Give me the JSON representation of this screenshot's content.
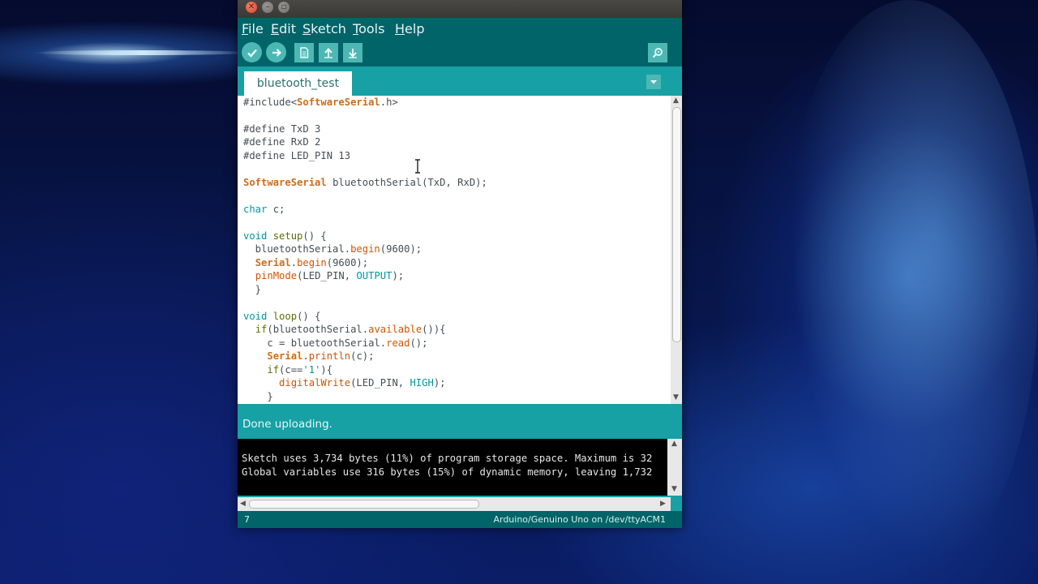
{
  "window": {
    "menu": [
      "File",
      "Edit",
      "Sketch",
      "Tools",
      "Help"
    ],
    "menu_mnemonic_rest": [
      "ile",
      "dit",
      "ketch",
      "ools",
      "elp"
    ],
    "menu_mnemonic_first": [
      "F",
      "E",
      "S",
      "T",
      "H"
    ]
  },
  "toolbar": {
    "verify_icon": "checkmark-icon",
    "upload_icon": "arrow-right-icon",
    "new_icon": "document-icon",
    "open_icon": "arrow-up-icon",
    "save_icon": "arrow-down-icon",
    "serial_monitor_icon": "magnifier-icon"
  },
  "tab": {
    "name": "bluetooth_test"
  },
  "code": {
    "l1_a": "#include<",
    "l1_b": "SoftwareSerial",
    "l1_c": ".h>",
    "l3": "#define TxD 3",
    "l4": "#define RxD 2",
    "l5": "#define LED_PIN 13",
    "l7_a": "SoftwareSerial",
    "l7_b": " bluetoothSerial(TxD, RxD);",
    "l9_a": "char",
    "l9_b": " c;",
    "l11_a": "void",
    "l11_b": " ",
    "l11_c": "setup",
    "l11_d": "() {",
    "l12_a": "  bluetoothSerial.",
    "l12_b": "begin",
    "l12_c": "(9600);",
    "l13_a": "  ",
    "l13_b": "Serial",
    "l13_c": ".",
    "l13_d": "begin",
    "l13_e": "(9600);",
    "l14_a": "  ",
    "l14_b": "pinMode",
    "l14_c": "(LED_PIN, ",
    "l14_d": "OUTPUT",
    "l14_e": ");",
    "l15": "  }",
    "l17_a": "void",
    "l17_b": " ",
    "l17_c": "loop",
    "l17_d": "() {",
    "l18_a": "  ",
    "l18_b": "if",
    "l18_c": "(bluetoothSerial.",
    "l18_d": "available",
    "l18_e": "()){",
    "l19_a": "    c = bluetoothSerial.",
    "l19_b": "read",
    "l19_c": "();",
    "l20_a": "    ",
    "l20_b": "Serial",
    "l20_c": ".",
    "l20_d": "println",
    "l20_e": "(c);",
    "l21_a": "    ",
    "l21_b": "if",
    "l21_c": "(c==",
    "l21_d": "'1'",
    "l21_e": "){",
    "l22_a": "      ",
    "l22_b": "digitalWrite",
    "l22_c": "(LED_PIN, ",
    "l22_d": "HIGH",
    "l22_e": ");",
    "l23": "    }"
  },
  "status": {
    "message": "Done uploading."
  },
  "console": {
    "line1": "Sketch uses 3,734 bytes (11%) of program storage space. Maximum is 32",
    "line2": "Global variables use 316 bytes (15%) of dynamic memory, leaving 1,732"
  },
  "footer": {
    "line_number": "7",
    "board": "Arduino/Genuino Uno on /dev/ttyACM1"
  },
  "colors": {
    "teal": "#17a1a5",
    "dark_teal": "#006468",
    "button": "#4db7b4"
  }
}
